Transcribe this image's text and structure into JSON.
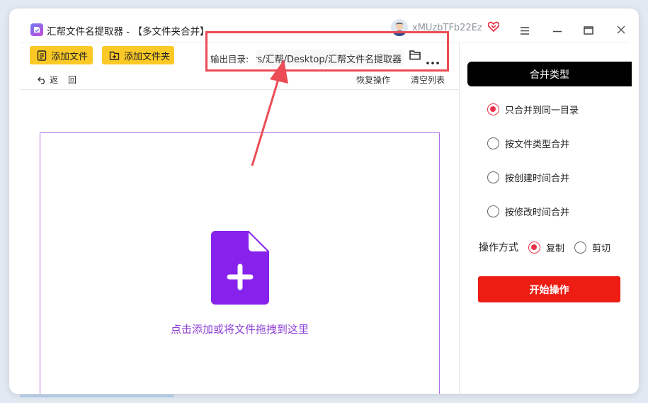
{
  "window": {
    "title": "汇帮文件名提取器 - 【多文件夹合并】",
    "username": "xMUzbTFb22Ez"
  },
  "toolbar": {
    "add_file_label": "添加文件",
    "add_folder_label": "添加文件夹",
    "output_label": "输出目录:",
    "output_path": "rs/汇帮/Desktop/汇帮文件名提取器",
    "back_label": "返",
    "back_label_2": "回",
    "restore_label": "恢复操作",
    "clear_label": "清空列表"
  },
  "dropzone": {
    "hint": "点击添加或将文件拖拽到这里"
  },
  "right_panel": {
    "merge_header": "合并类型",
    "options": [
      {
        "label": "只合并到同一目录",
        "selected": true
      },
      {
        "label": "按文件类型合并",
        "selected": false
      },
      {
        "label": "按创建时间合并",
        "selected": false
      },
      {
        "label": "按修改时间合并",
        "selected": false
      }
    ],
    "mode_label": "操作方式",
    "mode_copy": "复制",
    "mode_cut": "剪切",
    "start_label": "开始操作"
  },
  "colors": {
    "accent_yellow": "#fbc926",
    "accent_red": "#ee1d14",
    "radio_red": "#e8334a",
    "purple": "#8d3fd6",
    "highlight": "#ec4c55"
  },
  "icons": [
    "app-icon",
    "vip-heart-icon",
    "menu-icon",
    "minimize-icon",
    "maximize-icon",
    "close-icon",
    "file-icon",
    "folder-plus-icon",
    "back-icon",
    "folder-icon",
    "more-icon",
    "file-plus-icon"
  ]
}
